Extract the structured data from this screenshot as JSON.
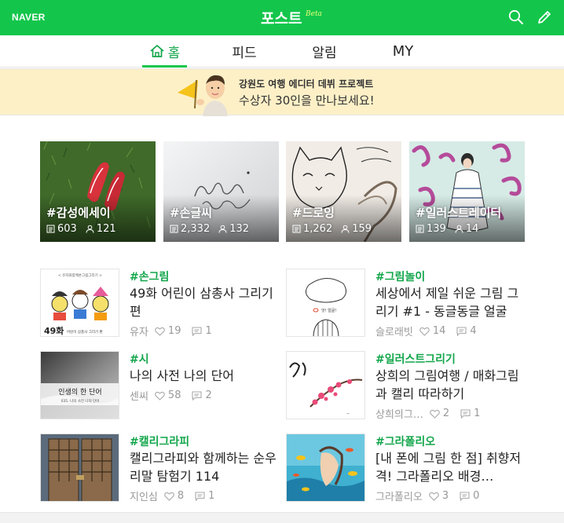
{
  "header": {
    "logo": "NAVER",
    "title": "포스트",
    "beta": "Beta"
  },
  "tabs": [
    {
      "label": "홈"
    },
    {
      "label": "피드"
    },
    {
      "label": "알림"
    },
    {
      "label": "MY"
    }
  ],
  "banner": {
    "title": "강원도 여행 에디터 데뷔 프로젝트",
    "subtitle": "수상자 30인을 만나보세요!"
  },
  "categories": [
    {
      "title": "#감성에세이",
      "posts": "603",
      "followers": "121"
    },
    {
      "title": "#손글씨",
      "posts": "2,332",
      "followers": "132"
    },
    {
      "title": "#드로잉",
      "posts": "1,262",
      "followers": "159"
    },
    {
      "title": "#일러스트레이터",
      "posts": "139",
      "followers": "14"
    }
  ],
  "posts": [
    {
      "tag": "#손그림",
      "title": "49화 어린이 삼총사 그리기편",
      "author": "유자",
      "likes": "19",
      "comments": "1"
    },
    {
      "tag": "#그림놀이",
      "title": "세상에서 제일 쉬운 그림 그리기 #1 - 동글동글 얼굴",
      "author": "슬로래빗",
      "likes": "14",
      "comments": "4"
    },
    {
      "tag": "#시",
      "title": "나의 사전 나의 단어",
      "author": "센씨",
      "likes": "58",
      "comments": "2"
    },
    {
      "tag": "#일러스트그리기",
      "title": "상희의 그림여행 / 매화그림과 캘리 따라하기",
      "author": "상희의그…",
      "likes": "2",
      "comments": "1"
    },
    {
      "tag": "#캘리그라피",
      "title": "캘리그라피와 함께하는 순우리말 탐험기 114",
      "author": "지인심",
      "likes": "8",
      "comments": "1"
    },
    {
      "tag": "#그라폴리오",
      "title": "[내 폰에 그림 한 점] 취향저격! 그라폴리오 배경…",
      "author": "그라폴리오",
      "likes": "3",
      "comments": "0"
    }
  ],
  "thumb_text": {
    "kids_top": "< 유자와함께손그림그리기 >",
    "kids_num": "49화",
    "kids_caption": "어린이 삼총사 그리기 편",
    "dict_title": "인생의 한 단어",
    "dict_caption": "035. 나의 사전 나의 단어",
    "face_text": "앗! 얼굴!"
  },
  "colors": {
    "brand": "#13c64b",
    "tag": "#13a64b",
    "banner_bg": "#fdf0c7"
  },
  "icons": {
    "search": "search-icon",
    "write": "pencil-icon",
    "home": "home-icon",
    "like": "heart-icon",
    "comment": "comment-icon",
    "posts": "document-icon",
    "followers": "person-icon"
  }
}
